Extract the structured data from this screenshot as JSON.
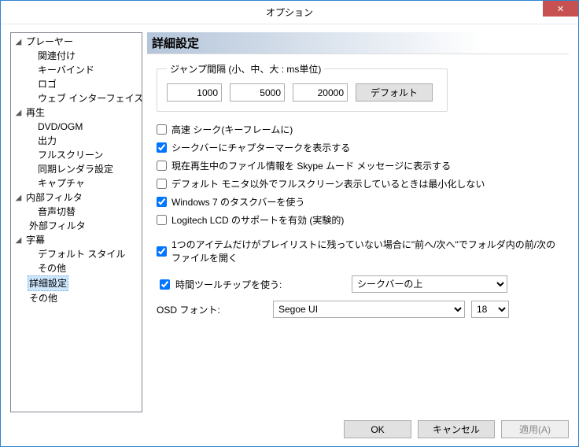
{
  "window": {
    "title": "オプション",
    "close": "✕"
  },
  "tree": {
    "player": {
      "label": "プレーヤー",
      "assoc": "関連付け",
      "keybind": "キーバインド",
      "logo": "ロゴ",
      "webui": "ウェブ インターフェイス"
    },
    "playback": {
      "label": "再生",
      "dvdogm": "DVD/OGM",
      "output": "出力",
      "fullscreen": "フルスクリーン",
      "syncrender": "同期レンダラ設定",
      "capture": "キャプチャ"
    },
    "internal": {
      "label": "内部フィルタ",
      "audioswitch": "音声切替"
    },
    "external": {
      "label": "外部フィルタ"
    },
    "subs": {
      "label": "字幕",
      "defstyle": "デフォルト スタイル",
      "misc": "その他"
    },
    "advanced": "詳細設定",
    "other": "その他"
  },
  "pane": {
    "title": "詳細設定",
    "jump": {
      "legend": "ジャンプ間隔 (小、中、大 : ms単位)",
      "small": "1000",
      "medium": "5000",
      "large": "20000",
      "default_btn": "デフォルト"
    },
    "checks": {
      "fastseek": {
        "label": "高速 シーク(キーフレームに)",
        "checked": false
      },
      "chapter_marks": {
        "label": "シークバーにチャプターマークを表示する",
        "checked": true
      },
      "skype": {
        "label": "現在再生中のファイル情報を Skype ムード メッセージに表示する",
        "checked": false
      },
      "no_minimize": {
        "label": "デフォルト モニタ以外でフルスクリーン表示しているときは最小化しない",
        "checked": false
      },
      "win7tb": {
        "label": "Windows 7 のタスクバーを使う",
        "checked": true
      },
      "logitech": {
        "label": "Logitech LCD のサポートを有効 (実験的)",
        "checked": false
      },
      "playlist_nav": {
        "label": "1つのアイテムだけがプレイリストに残っていない場合に\"前へ/次へ\"でフォルダ内の前/次のファイルを開く",
        "checked": true
      }
    },
    "tooltip": {
      "checked": true,
      "label": "時間ツールチップを使う:",
      "value": "シークバーの上"
    },
    "osd": {
      "label": "OSD フォント:",
      "font": "Segoe UI",
      "size": "18"
    }
  },
  "footer": {
    "ok": "OK",
    "cancel": "キャンセル",
    "apply": "適用(A)"
  }
}
